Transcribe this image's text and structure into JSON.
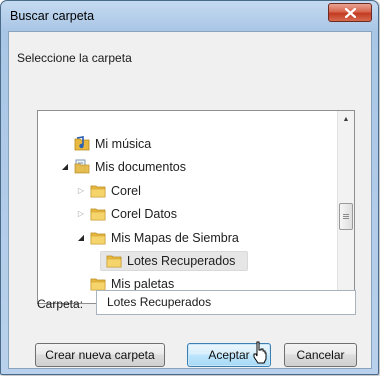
{
  "window": {
    "title": "Buscar carpeta"
  },
  "dialog": {
    "prompt": "Seleccione la carpeta"
  },
  "tree": {
    "items": [
      {
        "label": "Mi música",
        "level": 1,
        "expander": "none",
        "icon": "music-folder-icon",
        "selected": false
      },
      {
        "label": "Mis documentos",
        "level": 1,
        "expander": "expanded",
        "icon": "documents-folder-icon",
        "selected": false
      },
      {
        "label": "Corel",
        "level": 2,
        "expander": "collapsed",
        "icon": "folder-icon",
        "selected": false
      },
      {
        "label": "Corel Datos",
        "level": 2,
        "expander": "collapsed",
        "icon": "folder-icon",
        "selected": false
      },
      {
        "label": "Mis Mapas de Siembra",
        "level": 2,
        "expander": "expanded",
        "icon": "folder-icon",
        "selected": false
      },
      {
        "label": "Lotes Recuperados",
        "level": 3,
        "expander": "none",
        "icon": "folder-icon",
        "selected": true
      },
      {
        "label": "Mis paletas",
        "level": 2,
        "expander": "none",
        "icon": "folder-icon",
        "selected": false
      }
    ]
  },
  "folder_field": {
    "label": "Carpeta:",
    "value": "Lotes Recuperados"
  },
  "buttons": {
    "new_folder": "Crear nueva carpeta",
    "accept": "Aceptar",
    "cancel": "Cancelar"
  },
  "colors": {
    "titlebar": "#b9d1ec",
    "close_button": "#c23b22",
    "folder": "#e7b93f",
    "default_button": "#bee6fd"
  }
}
